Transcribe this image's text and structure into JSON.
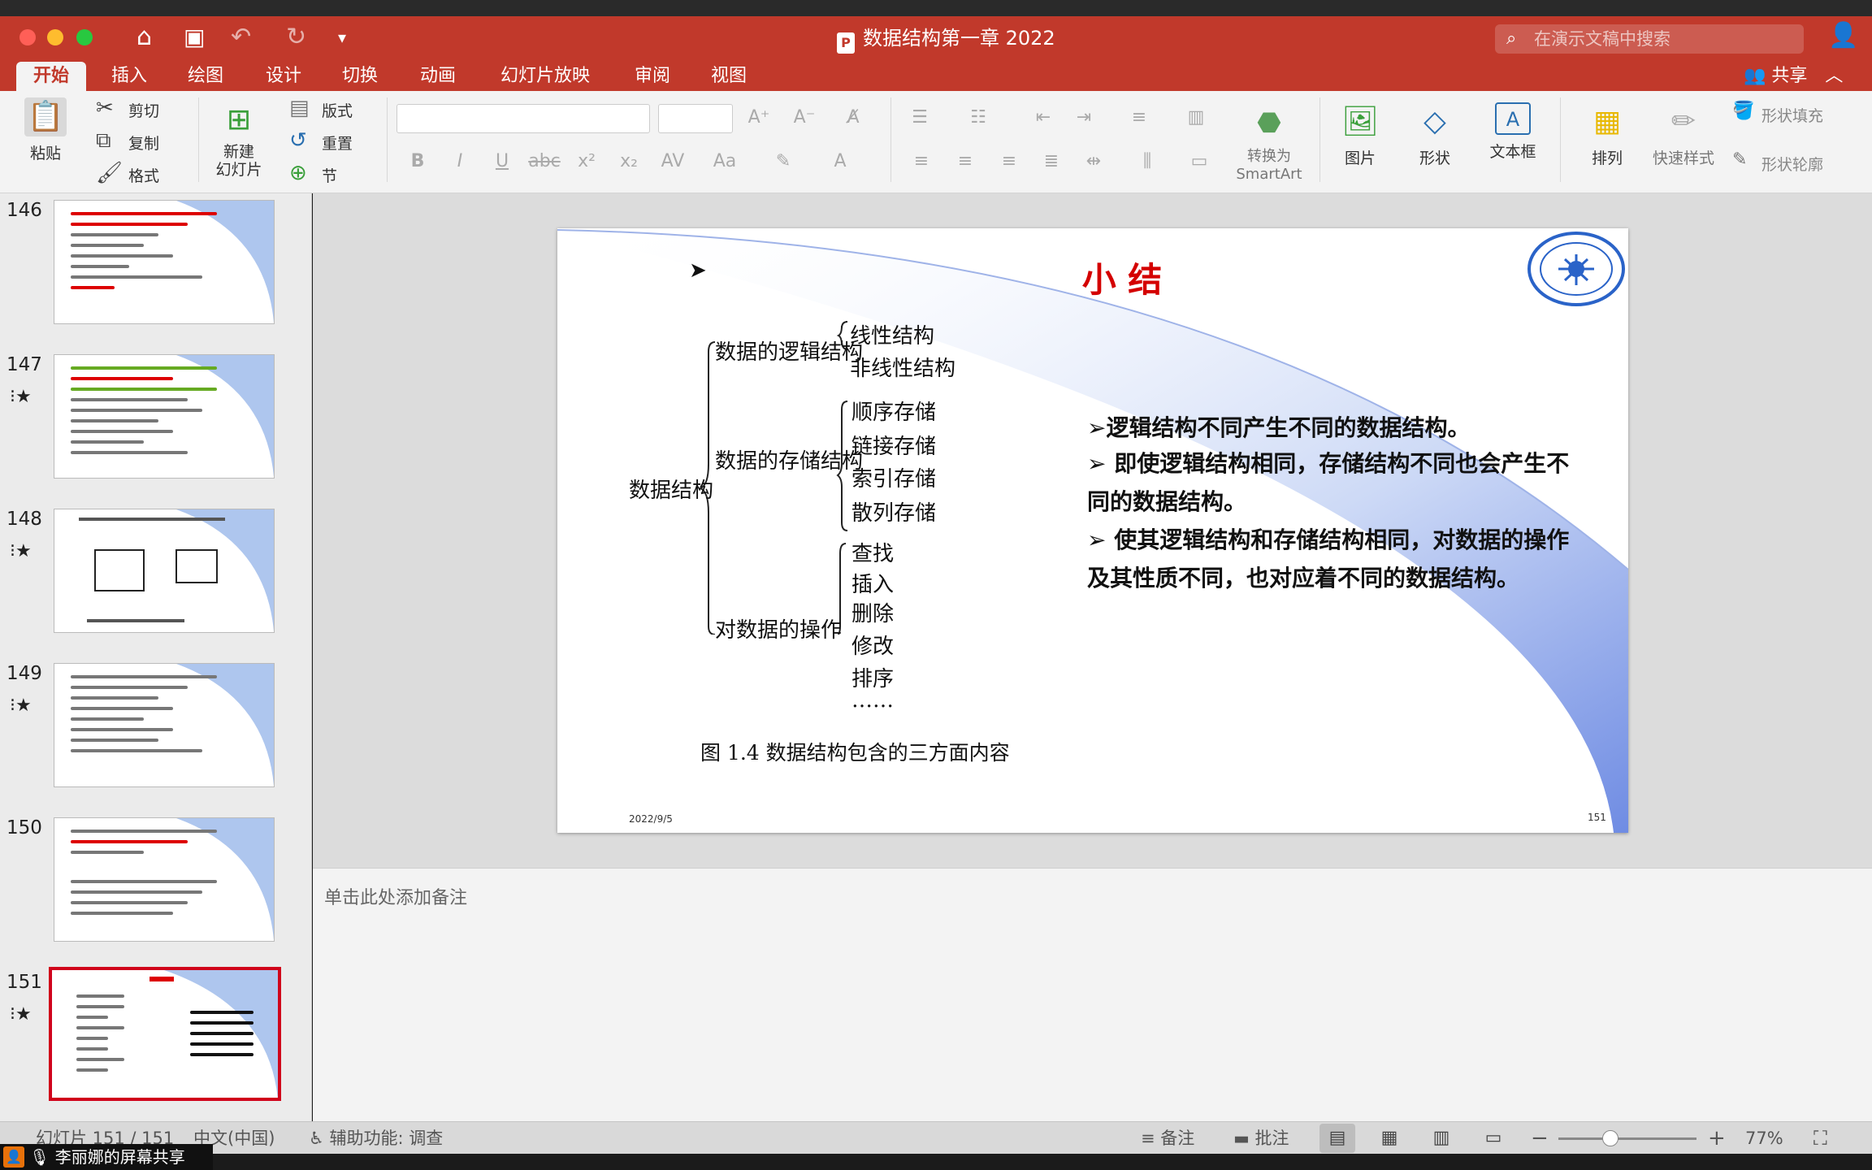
{
  "window": {
    "title": "数据结构第一章 2022",
    "search_placeholder": "在演示文稿中搜索",
    "share_label": "共享"
  },
  "menu": {
    "tabs": [
      "开始",
      "插入",
      "绘图",
      "设计",
      "切换",
      "动画",
      "幻灯片放映",
      "审阅",
      "视图"
    ]
  },
  "ribbon": {
    "paste": "粘贴",
    "cut": "剪切",
    "copy": "复制",
    "format": "格式",
    "new_slide": "新建\n幻灯片",
    "layout": "版式",
    "reset": "重置",
    "section": "节",
    "convert_smartart_1": "转换为",
    "convert_smartart_2": "SmartArt",
    "picture": "图片",
    "shape": "形状",
    "textbox": "文本框",
    "arrange": "排列",
    "quick_styles": "快速样式",
    "shape_fill": "形状填充",
    "shape_outline": "形状轮廓"
  },
  "thumbnails": [
    {
      "number": "146",
      "starred": false
    },
    {
      "number": "147",
      "starred": true
    },
    {
      "number": "148",
      "starred": true
    },
    {
      "number": "149",
      "starred": true
    },
    {
      "number": "150",
      "starred": false
    },
    {
      "number": "151",
      "starred": true
    }
  ],
  "slide": {
    "title": "小 结",
    "root": "数据结构",
    "branch_logic": "数据的逻辑结构",
    "branch_storage": "数据的存储结构",
    "branch_ops": "对数据的操作",
    "logic_items": [
      "线性结构",
      "非线性结构"
    ],
    "storage_items": [
      "顺序存储",
      "链接存储",
      "索引存储",
      "散列存储"
    ],
    "ops_items": [
      "查找",
      "插入",
      "删除",
      "修改",
      "排序",
      "……"
    ],
    "caption": "图 1.4  数据结构包含的三方面内容",
    "bullet_1": "逻辑结构不同产生不同的数据结构。",
    "bullet_2": " 即使逻辑结构相同，存储结构不同也会产生不同的数据结构。",
    "bullet_3": " 使其逻辑结构和存储结构相同，对数据的操作及其性质不同，也对应着不同的数据结构。",
    "footer_date": "2022/9/5",
    "footer_page": "151"
  },
  "notes": {
    "placeholder": "单击此处添加备注"
  },
  "status": {
    "slide_count": "幻灯片 151 / 151",
    "language": "中文(中国)",
    "accessibility": "辅助功能: 调查",
    "notes_btn": "备注",
    "comments_btn": "批注",
    "zoom": "77%"
  },
  "screen_share": {
    "label": "李丽娜的屏幕共享"
  }
}
